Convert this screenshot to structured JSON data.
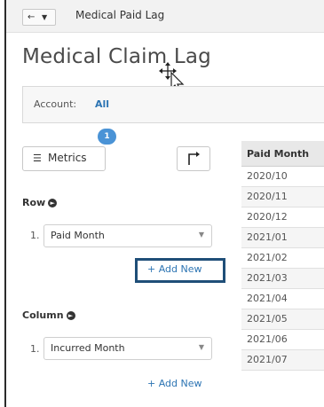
{
  "header": {
    "back_icon": "left-arrow-icon",
    "dropdown_icon": "caret-down-icon",
    "breadcrumb": "Medical Paid Lag"
  },
  "page": {
    "title": "Medical Claim Lag"
  },
  "account": {
    "label": "Account:",
    "value": "All"
  },
  "metrics": {
    "label": "Metrics",
    "badge": "1",
    "icon": "list-icon"
  },
  "pivot_icon": "pivot-icon",
  "row_section": {
    "label": "Row",
    "index": "1.",
    "selected": "Paid Month",
    "add_label": "+ Add New"
  },
  "column_section": {
    "label": "Column",
    "index": "1.",
    "selected": "Incurred Month",
    "add_label": "+ Add New"
  },
  "table": {
    "header": "Paid Month",
    "rows": [
      "2020/10",
      "2020/11",
      "2020/12",
      "2021/01",
      "2021/02",
      "2021/03",
      "2021/04",
      "2021/05",
      "2021/06",
      "2021/07"
    ]
  },
  "colors": {
    "link": "#2c74b3",
    "badge": "#4a93d6",
    "highlight": "#1f4e78"
  }
}
